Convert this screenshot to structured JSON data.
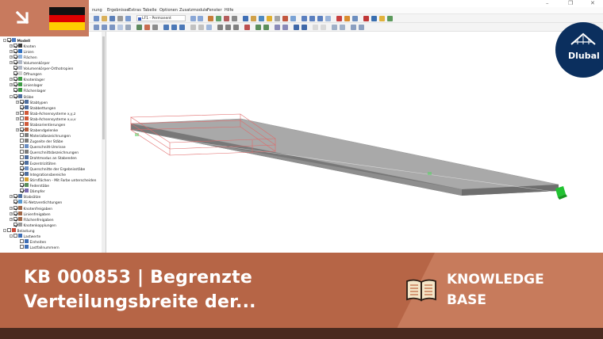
{
  "window": {
    "controls": [
      "–",
      "❐",
      "✕"
    ]
  },
  "menubar": {
    "items": [
      "nung",
      "Ergebnisse",
      "Extras",
      "Tabelle",
      "Optionen",
      "Zusatzmodule",
      "Fenster",
      "Hilfe"
    ]
  },
  "toolbar": {
    "load_case": "LF1 - Permanent"
  },
  "navigator": {
    "items": [
      {
        "label": "Modell",
        "level": 0,
        "expander": "-",
        "checked": true,
        "icon": "model-icon",
        "bold": true
      },
      {
        "label": "Knoten",
        "level": 1,
        "expander": "+",
        "checked": true,
        "icon": "node-icon"
      },
      {
        "label": "Linien",
        "level": 1,
        "expander": "+",
        "checked": true,
        "icon": "line-icon"
      },
      {
        "label": "Flächen",
        "level": 1,
        "expander": "+",
        "checked": true,
        "icon": "surface-icon"
      },
      {
        "label": "Volumenkörper",
        "level": 1,
        "expander": "+",
        "checked": true,
        "icon": "solid-icon"
      },
      {
        "label": "Volumenkörper-Orthotropien",
        "level": 1,
        "expander": "",
        "checked": true,
        "icon": "solid-icon"
      },
      {
        "label": "Öffnungen",
        "level": 1,
        "expander": "",
        "checked": true,
        "icon": "opening-icon"
      },
      {
        "label": "Knotenlager",
        "level": 1,
        "expander": "+",
        "checked": true,
        "icon": "support-icon"
      },
      {
        "label": "Linienlager",
        "level": 1,
        "expander": "+",
        "checked": true,
        "icon": "support-icon"
      },
      {
        "label": "Flächenlager",
        "level": 1,
        "expander": "",
        "checked": true,
        "icon": "support-icon"
      },
      {
        "label": "Stäbe",
        "level": 1,
        "expander": "-",
        "checked": true,
        "icon": "member-icon"
      },
      {
        "label": "Stabtypen",
        "level": 2,
        "expander": "+",
        "checked": true,
        "icon": "member-icon"
      },
      {
        "label": "Stabbettungen",
        "level": 2,
        "expander": "",
        "checked": true,
        "icon": "member-icon"
      },
      {
        "label": "Stab-Achsensysteme x,y,z",
        "level": 2,
        "expander": "+",
        "checked": false,
        "icon": "axis-icon"
      },
      {
        "label": "Stab-Achsensysteme x,u,v",
        "level": 2,
        "expander": "+",
        "checked": false,
        "icon": "axis-icon"
      },
      {
        "label": "Stabsorientierungen",
        "level": 2,
        "expander": "",
        "checked": false,
        "icon": "axis-icon"
      },
      {
        "label": "Stabendgelenke",
        "level": 2,
        "expander": "+",
        "checked": true,
        "icon": "hinge-icon"
      },
      {
        "label": "Materialbezeichnungen",
        "level": 2,
        "expander": "",
        "checked": false,
        "icon": "text-icon"
      },
      {
        "label": "Zugseite der Stäbe",
        "level": 2,
        "expander": "",
        "checked": false,
        "icon": "text-icon"
      },
      {
        "label": "Querschnitt-Umrisse",
        "level": 2,
        "expander": "",
        "checked": false,
        "icon": "section-icon"
      },
      {
        "label": "Querschnittsbezeichnungen",
        "level": 2,
        "expander": "",
        "checked": false,
        "icon": "text-icon"
      },
      {
        "label": "Drahtmodus an Stabenden",
        "level": 2,
        "expander": "",
        "checked": false,
        "icon": "member-icon"
      },
      {
        "label": "Exzentrizitäten",
        "level": 2,
        "expander": "",
        "checked": true,
        "icon": "member-icon"
      },
      {
        "label": "Querschnitte der Ergebnisstäbe",
        "level": 2,
        "expander": "",
        "checked": true,
        "icon": "section-icon"
      },
      {
        "label": "Integrationsbereiche",
        "level": 2,
        "expander": "",
        "checked": true,
        "icon": "member-icon"
      },
      {
        "label": "Stirnflächen - Mit Farbe unterscheiden",
        "level": 2,
        "expander": "",
        "checked": false,
        "icon": "color-icon"
      },
      {
        "label": "Federstäbe",
        "level": 2,
        "expander": "",
        "checked": true,
        "icon": "spring-icon"
      },
      {
        "label": "Dämpfer",
        "level": 2,
        "expander": "",
        "checked": true,
        "icon": "damper-icon"
      },
      {
        "label": "Stabsätze",
        "level": 1,
        "expander": "+",
        "checked": true,
        "icon": "member-icon"
      },
      {
        "label": "FE-Netzverdichtungen",
        "level": 1,
        "expander": "",
        "checked": true,
        "icon": "mesh-icon"
      },
      {
        "label": "Knotenfreigaben",
        "level": 1,
        "expander": "+",
        "checked": true,
        "icon": "release-icon"
      },
      {
        "label": "Linienfreigaben",
        "level": 1,
        "expander": "+",
        "checked": true,
        "icon": "release-icon"
      },
      {
        "label": "Flächenfreigaben",
        "level": 1,
        "expander": "+",
        "checked": true,
        "icon": "release-icon"
      },
      {
        "label": "Knotenkopplungen",
        "level": 1,
        "expander": "",
        "checked": true,
        "icon": "coupling-icon"
      },
      {
        "label": "Belastung",
        "level": 0,
        "expander": "-",
        "checked": false,
        "icon": "load-icon"
      },
      {
        "label": "Lastwerte",
        "level": 1,
        "expander": "-",
        "checked": false,
        "icon": "load-value-icon"
      },
      {
        "label": "Einheiten",
        "level": 2,
        "expander": "",
        "checked": false,
        "icon": "load-value-icon"
      },
      {
        "label": "Lastfallnummern",
        "level": 2,
        "expander": "",
        "checked": false,
        "icon": "load-value-icon"
      }
    ]
  },
  "branding": {
    "logo_text": "Dlubal",
    "colors": {
      "banner": "#b66546",
      "banner_light": "#c77b5c",
      "logo_navy": "#0b2f5e",
      "support_green": "#22c232"
    }
  },
  "banner": {
    "title_line1": "KB 000853 | Begrenzte",
    "title_line2": "Verteilungsbreite der...",
    "category_line1": "KNOWLEDGE",
    "category_line2": "BASE"
  },
  "flag": {
    "country": "Germany"
  }
}
